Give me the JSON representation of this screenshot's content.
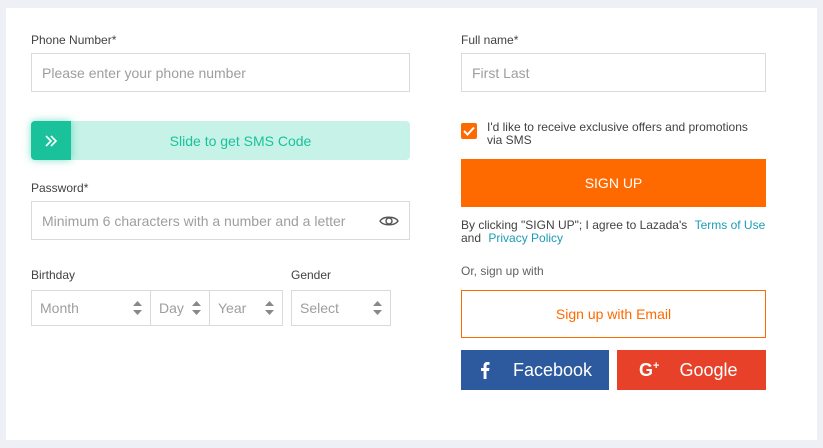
{
  "colors": {
    "accent": "#ff6a00",
    "slider_bg": "#c6f2e8",
    "slider_knob": "#1ac29b",
    "link": "#1a9cb7",
    "facebook": "#2d5a9e",
    "google": "#e8412a"
  },
  "phone": {
    "label": "Phone Number*",
    "placeholder": "Please enter your phone number"
  },
  "sms_slider": {
    "text": "Slide to get SMS Code",
    "icon": "double-chevron-right-icon"
  },
  "password": {
    "label": "Password*",
    "placeholder": "Minimum 6 characters with a number and a letter",
    "icon": "eye-icon"
  },
  "birthday": {
    "label": "Birthday",
    "month": "Month",
    "day": "Day",
    "year": "Year"
  },
  "gender": {
    "label": "Gender",
    "value": "Select"
  },
  "full_name": {
    "label": "Full name*",
    "placeholder": "First Last"
  },
  "offers": {
    "checked": true,
    "line1": "I'd like to receive exclusive offers and promotions",
    "line2": "via SMS"
  },
  "signup_button": "SIGN UP",
  "terms": {
    "prefix": "By clicking \"SIGN UP\"; I agree to Lazada's",
    "terms_link": "Terms of Use",
    "and": "and",
    "privacy_link": "Privacy Policy"
  },
  "or_text": "Or, sign up with",
  "email_button": "Sign up with Email",
  "facebook_button": "Facebook",
  "google_button": "Google"
}
